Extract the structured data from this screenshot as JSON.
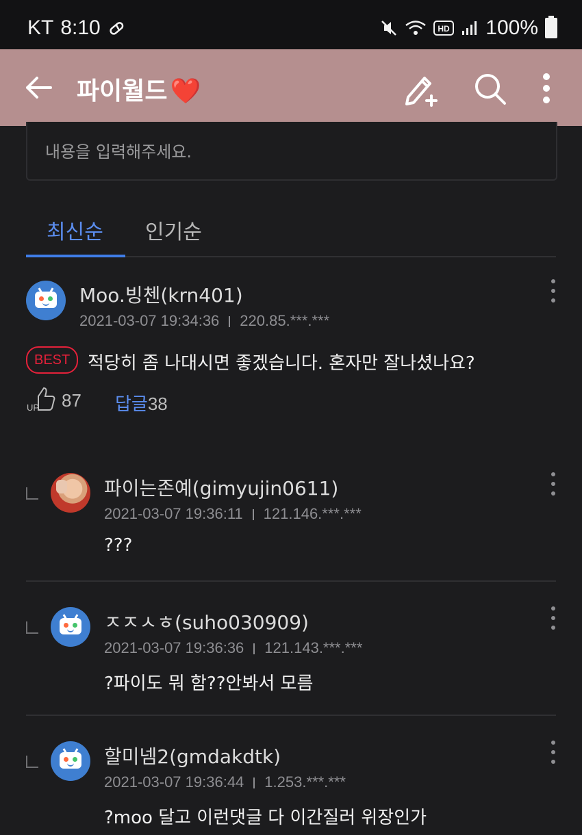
{
  "status_bar": {
    "carrier": "KT",
    "time": "8:10",
    "battery": "100%"
  },
  "app_bar": {
    "title": "파이월드",
    "title_emoji": "❤️"
  },
  "comment_input": {
    "placeholder": "내용을 입력해주세요."
  },
  "tabs": [
    {
      "label": "최신순",
      "active": true
    },
    {
      "label": "인기순",
      "active": false
    }
  ],
  "best_comment": {
    "badge": "BEST",
    "author": "Moo.빙첸(krn401)",
    "date": "2021-03-07 19:34:36",
    "ip": "220.85.***.***",
    "text": "적당히 좀 나대시면 좋겠습니다. 혼자만 잘나셨나요?",
    "up_label": "UP",
    "likes": "87",
    "reply_label": "답글",
    "reply_count": "38"
  },
  "replies": [
    {
      "author": "파이는존예(gimyujin0611)",
      "date": "2021-03-07 19:36:11",
      "ip": "121.146.***.***",
      "text": "???",
      "avatar": "photo"
    },
    {
      "author": "ㅈㅈㅅㅎ(suho030909)",
      "date": "2021-03-07 19:36:36",
      "ip": "121.143.***.***",
      "text": "?파이도 뭐 함??안봐서 모름",
      "avatar": "default-tv-icon"
    },
    {
      "author": "할미넴2(gmdakdtk)",
      "date": "2021-03-07 19:36:44",
      "ip": "1.253.***.***",
      "text": "?moo 달고 이런댓글 다 이간질러 위장인가",
      "avatar": "default-tv-icon"
    }
  ],
  "colors": {
    "app_bar": "#b58f8f",
    "accent": "#5b8def",
    "best": "#e5213a",
    "background": "#1c1c1e"
  }
}
